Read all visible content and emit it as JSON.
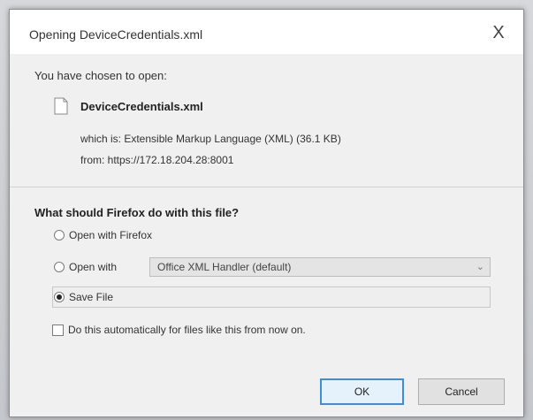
{
  "dialog": {
    "title": "Opening DeviceCredentials.xml",
    "close_label": "X",
    "chosen_label": "You have chosen to open:",
    "file_icon": "file-icon",
    "file_name": "DeviceCredentials.xml",
    "which_is": "which is: Extensible Markup Language (XML) (36.1 KB)",
    "from": "from: https://172.18.204.28:8001",
    "question": "What should Firefox do with this file?",
    "options": {
      "open_firefox": "Open with Firefox",
      "open_with": "Open with",
      "save_file": "Save File"
    },
    "selected_option": "save_file",
    "handler_select_value": "Office XML Handler (default)",
    "auto_checkbox_label": "Do this automatically for files like this from now on.",
    "auto_checked": false,
    "ok_label": "OK",
    "cancel_label": "Cancel"
  }
}
